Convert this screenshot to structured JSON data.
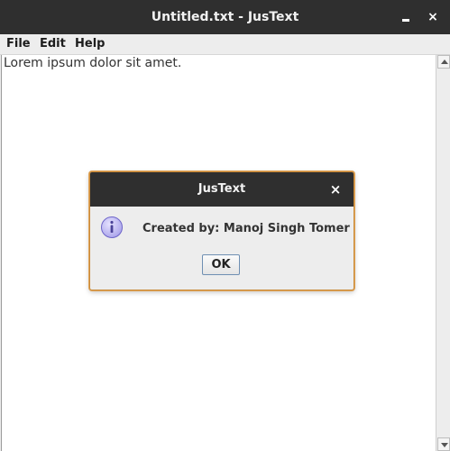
{
  "window": {
    "title": "Untitled.txt - JusText",
    "minimize_symbol": "",
    "close_symbol": "×"
  },
  "menu": {
    "items": [
      {
        "label": "File"
      },
      {
        "label": "Edit"
      },
      {
        "label": "Help"
      }
    ]
  },
  "editor": {
    "content": "Lorem ipsum dolor sit amet."
  },
  "dialog": {
    "title": "JusText",
    "close_symbol": "×",
    "icon": "info-icon",
    "message": "Created by: Manoj Singh Tomer",
    "ok_label": "OK"
  },
  "colors": {
    "titlebar": "#2f2f2f",
    "dialog_border": "#c98a3a",
    "ok_border": "#6f8fb3",
    "info_icon_fill": "#b9b3ef"
  }
}
